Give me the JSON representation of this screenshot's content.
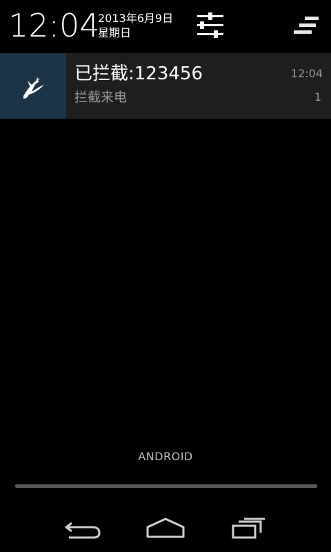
{
  "status": {
    "time": "12:04",
    "date_line1": "2013年6月9日",
    "date_line2": "星期日"
  },
  "header": {
    "settings_icon": "settings-sliders-icon",
    "menu_icon": "stacked-lines-icon"
  },
  "notification": {
    "app_icon": "bird-icon",
    "title": "已拦截:123456",
    "text": "拦截来电",
    "time": "12:04",
    "count": "1",
    "icon_bg": "#1c3447"
  },
  "carrier": "ANDROID",
  "navbar": {
    "back_icon": "back-icon",
    "home_icon": "home-icon",
    "recents_icon": "recents-icon"
  }
}
